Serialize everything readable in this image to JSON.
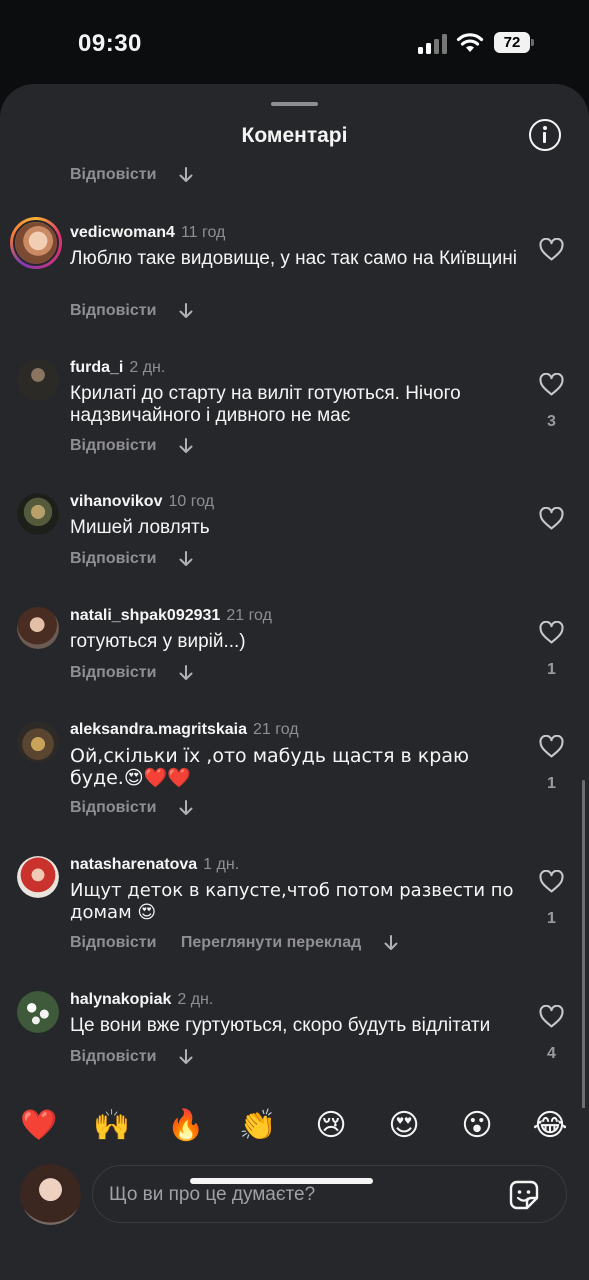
{
  "status_bar": {
    "time": "09:30",
    "battery": "72"
  },
  "sheet": {
    "title": "Коментарі"
  },
  "top_reply": {
    "reply_label": "Відповісти"
  },
  "comments": [
    {
      "username": "vedicwoman4",
      "time": "11 год",
      "text": "Люблю таке видовище, у нас так само на Київщині",
      "reply_label": "Відповісти",
      "likes": ""
    },
    {
      "username": "furda_i",
      "time": "2 дн.",
      "text": "Крилаті до старту на виліт готуються. Нічого надзвичайного і дивного не має",
      "reply_label": "Відповісти",
      "likes": "3"
    },
    {
      "username": "vihanovikov",
      "time": "10 год",
      "text": "Мишей ловлять",
      "reply_label": "Відповісти",
      "likes": ""
    },
    {
      "username": "natali_shpak092931",
      "time": "21 год",
      "text": "готуються у вирій...)",
      "reply_label": "Відповісти",
      "likes": "1"
    },
    {
      "username": "aleksandra.magritskaia",
      "time": "21 год",
      "text": "Ой,скільки їх ,ото мабудь щастя в краю буде.😍❤️❤️",
      "reply_label": "Відповісти",
      "likes": "1"
    },
    {
      "username": "natasharenatova",
      "time": "1 дн.",
      "text": "Ищут деток в капусте,чтоб потом развести по домам 😍",
      "reply_label": "Відповісти",
      "translate_label": "Переглянути переклад",
      "likes": "1"
    },
    {
      "username": "halynakopiak",
      "time": "2 дн.",
      "text": "Це вони вже гуртуються, скоро будуть відлітати",
      "reply_label": "Відповісти",
      "likes": "4"
    }
  ],
  "reactions": [
    "❤️",
    "🙌",
    "🔥",
    "👏",
    "😢",
    "😍",
    "😮",
    "😂"
  ],
  "composer": {
    "placeholder": "Що ви про це думаєте?"
  },
  "icons": {
    "heart": "heart-outline-icon",
    "info": "info-icon",
    "sticker": "sticker-icon",
    "arrow": "arrow-down-icon"
  }
}
